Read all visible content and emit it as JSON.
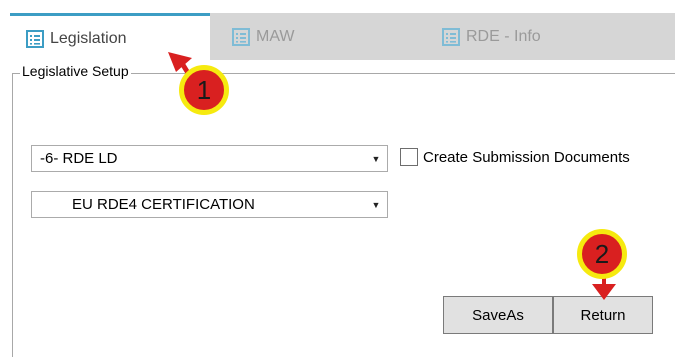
{
  "tabs": [
    {
      "label": "Legislation",
      "active": true,
      "icon": "form-icon"
    },
    {
      "label": "MAW",
      "active": false,
      "icon": "form-icon"
    },
    {
      "label": "RDE - Info",
      "active": false,
      "icon": "form-icon"
    }
  ],
  "group": {
    "legend": "Legislative Setup"
  },
  "legislation_select": {
    "value": "-6- RDE LD"
  },
  "certification_select": {
    "value": "EU RDE4 CERTIFICATION"
  },
  "create_docs": {
    "label": "Create Submission Documents",
    "checked": false
  },
  "buttons": {
    "save_as": "SaveAs",
    "return": "Return"
  },
  "annotations": [
    {
      "number": "1",
      "color": "#d92020",
      "ring": "#f6ea0f"
    },
    {
      "number": "2",
      "color": "#d92020",
      "ring": "#f6ea0f"
    }
  ],
  "colors": {
    "tab_accent": "#3c9dc4",
    "tab_bar": "#d6d6d6",
    "icon": "#3c9dc4"
  }
}
